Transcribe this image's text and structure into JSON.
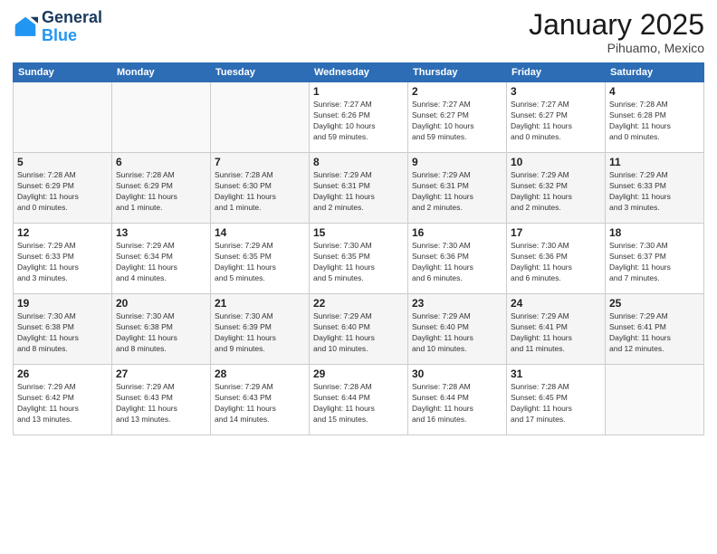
{
  "logo": {
    "line1": "General",
    "line2": "Blue"
  },
  "header": {
    "title": "January 2025",
    "subtitle": "Pihuamo, Mexico"
  },
  "weekdays": [
    "Sunday",
    "Monday",
    "Tuesday",
    "Wednesday",
    "Thursday",
    "Friday",
    "Saturday"
  ],
  "weeks": [
    [
      {
        "day": "",
        "info": ""
      },
      {
        "day": "",
        "info": ""
      },
      {
        "day": "",
        "info": ""
      },
      {
        "day": "1",
        "info": "Sunrise: 7:27 AM\nSunset: 6:26 PM\nDaylight: 10 hours\nand 59 minutes."
      },
      {
        "day": "2",
        "info": "Sunrise: 7:27 AM\nSunset: 6:27 PM\nDaylight: 10 hours\nand 59 minutes."
      },
      {
        "day": "3",
        "info": "Sunrise: 7:27 AM\nSunset: 6:27 PM\nDaylight: 11 hours\nand 0 minutes."
      },
      {
        "day": "4",
        "info": "Sunrise: 7:28 AM\nSunset: 6:28 PM\nDaylight: 11 hours\nand 0 minutes."
      }
    ],
    [
      {
        "day": "5",
        "info": "Sunrise: 7:28 AM\nSunset: 6:29 PM\nDaylight: 11 hours\nand 0 minutes."
      },
      {
        "day": "6",
        "info": "Sunrise: 7:28 AM\nSunset: 6:29 PM\nDaylight: 11 hours\nand 1 minute."
      },
      {
        "day": "7",
        "info": "Sunrise: 7:28 AM\nSunset: 6:30 PM\nDaylight: 11 hours\nand 1 minute."
      },
      {
        "day": "8",
        "info": "Sunrise: 7:29 AM\nSunset: 6:31 PM\nDaylight: 11 hours\nand 2 minutes."
      },
      {
        "day": "9",
        "info": "Sunrise: 7:29 AM\nSunset: 6:31 PM\nDaylight: 11 hours\nand 2 minutes."
      },
      {
        "day": "10",
        "info": "Sunrise: 7:29 AM\nSunset: 6:32 PM\nDaylight: 11 hours\nand 2 minutes."
      },
      {
        "day": "11",
        "info": "Sunrise: 7:29 AM\nSunset: 6:33 PM\nDaylight: 11 hours\nand 3 minutes."
      }
    ],
    [
      {
        "day": "12",
        "info": "Sunrise: 7:29 AM\nSunset: 6:33 PM\nDaylight: 11 hours\nand 3 minutes."
      },
      {
        "day": "13",
        "info": "Sunrise: 7:29 AM\nSunset: 6:34 PM\nDaylight: 11 hours\nand 4 minutes."
      },
      {
        "day": "14",
        "info": "Sunrise: 7:29 AM\nSunset: 6:35 PM\nDaylight: 11 hours\nand 5 minutes."
      },
      {
        "day": "15",
        "info": "Sunrise: 7:30 AM\nSunset: 6:35 PM\nDaylight: 11 hours\nand 5 minutes."
      },
      {
        "day": "16",
        "info": "Sunrise: 7:30 AM\nSunset: 6:36 PM\nDaylight: 11 hours\nand 6 minutes."
      },
      {
        "day": "17",
        "info": "Sunrise: 7:30 AM\nSunset: 6:36 PM\nDaylight: 11 hours\nand 6 minutes."
      },
      {
        "day": "18",
        "info": "Sunrise: 7:30 AM\nSunset: 6:37 PM\nDaylight: 11 hours\nand 7 minutes."
      }
    ],
    [
      {
        "day": "19",
        "info": "Sunrise: 7:30 AM\nSunset: 6:38 PM\nDaylight: 11 hours\nand 8 minutes."
      },
      {
        "day": "20",
        "info": "Sunrise: 7:30 AM\nSunset: 6:38 PM\nDaylight: 11 hours\nand 8 minutes."
      },
      {
        "day": "21",
        "info": "Sunrise: 7:30 AM\nSunset: 6:39 PM\nDaylight: 11 hours\nand 9 minutes."
      },
      {
        "day": "22",
        "info": "Sunrise: 7:29 AM\nSunset: 6:40 PM\nDaylight: 11 hours\nand 10 minutes."
      },
      {
        "day": "23",
        "info": "Sunrise: 7:29 AM\nSunset: 6:40 PM\nDaylight: 11 hours\nand 10 minutes."
      },
      {
        "day": "24",
        "info": "Sunrise: 7:29 AM\nSunset: 6:41 PM\nDaylight: 11 hours\nand 11 minutes."
      },
      {
        "day": "25",
        "info": "Sunrise: 7:29 AM\nSunset: 6:41 PM\nDaylight: 11 hours\nand 12 minutes."
      }
    ],
    [
      {
        "day": "26",
        "info": "Sunrise: 7:29 AM\nSunset: 6:42 PM\nDaylight: 11 hours\nand 13 minutes."
      },
      {
        "day": "27",
        "info": "Sunrise: 7:29 AM\nSunset: 6:43 PM\nDaylight: 11 hours\nand 13 minutes."
      },
      {
        "day": "28",
        "info": "Sunrise: 7:29 AM\nSunset: 6:43 PM\nDaylight: 11 hours\nand 14 minutes."
      },
      {
        "day": "29",
        "info": "Sunrise: 7:28 AM\nSunset: 6:44 PM\nDaylight: 11 hours\nand 15 minutes."
      },
      {
        "day": "30",
        "info": "Sunrise: 7:28 AM\nSunset: 6:44 PM\nDaylight: 11 hours\nand 16 minutes."
      },
      {
        "day": "31",
        "info": "Sunrise: 7:28 AM\nSunset: 6:45 PM\nDaylight: 11 hours\nand 17 minutes."
      },
      {
        "day": "",
        "info": ""
      }
    ]
  ]
}
